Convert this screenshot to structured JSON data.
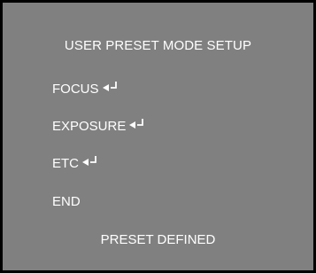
{
  "screen": {
    "background_color": "#808080",
    "border_color": "#000000",
    "text_color": "#ffffff"
  },
  "menu": {
    "title": "USER PRESET MODE SETUP",
    "items": [
      {
        "label": "FOCUS",
        "icon": "enter-icon"
      },
      {
        "label": "EXPOSURE",
        "icon": "enter-icon"
      },
      {
        "label": "ETC",
        "icon": "enter-icon"
      },
      {
        "label": "END"
      }
    ],
    "status": "PRESET DEFINED"
  }
}
